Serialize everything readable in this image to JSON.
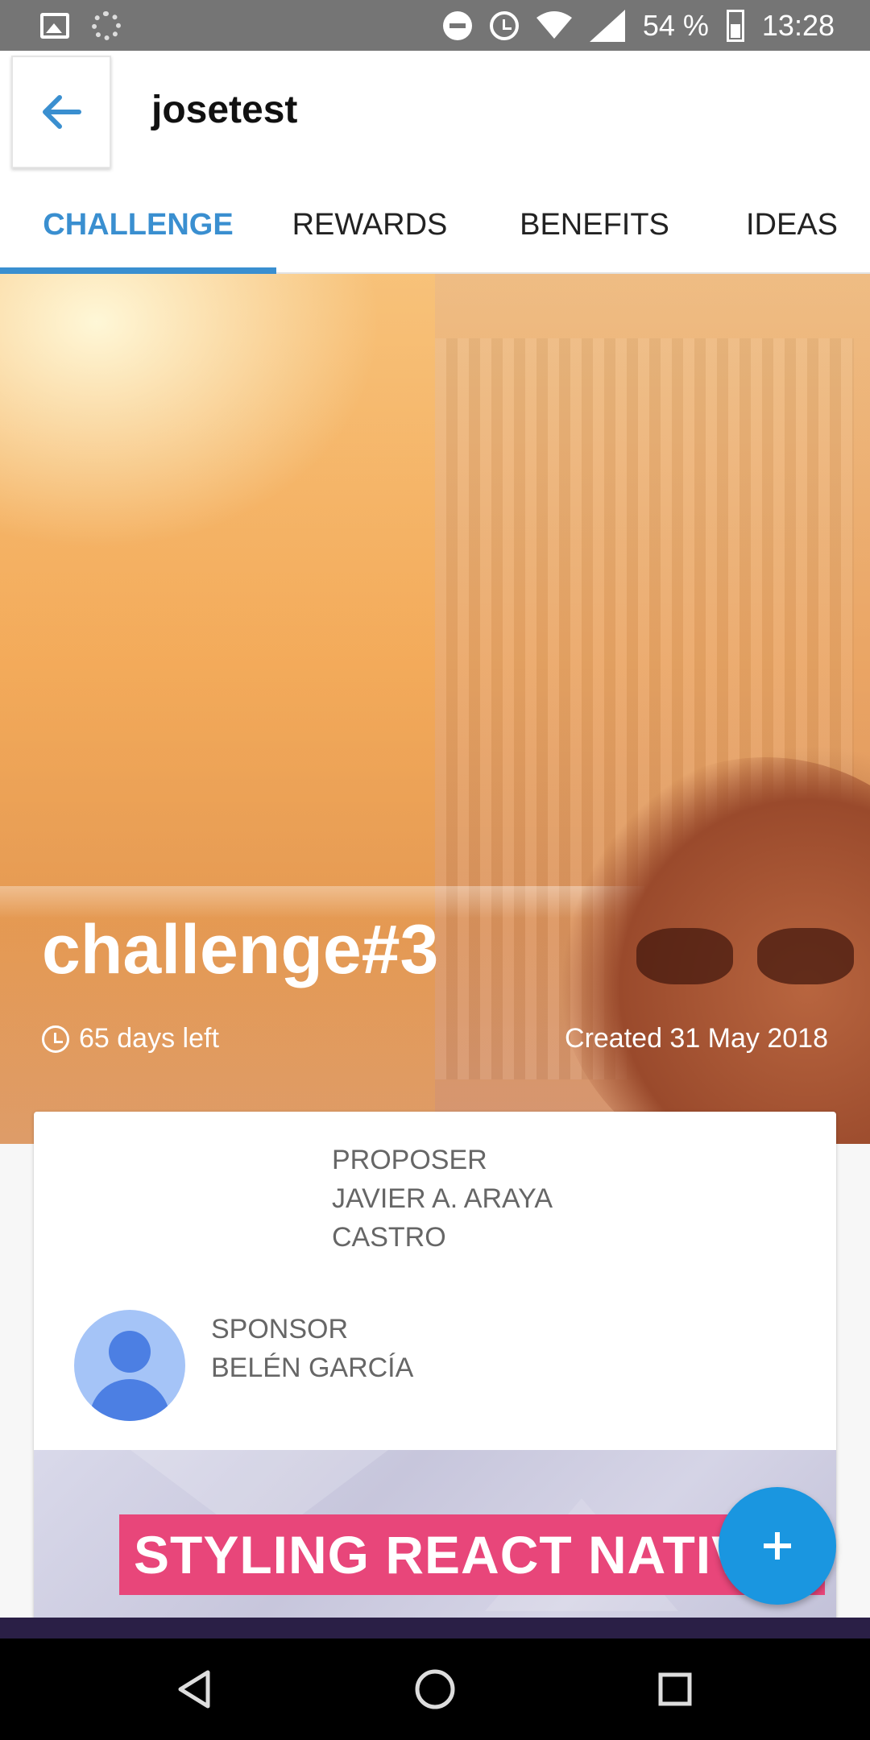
{
  "status_bar": {
    "battery": "54 %",
    "time": "13:28",
    "icons": [
      "image-icon",
      "loading-icon",
      "do-not-disturb-icon",
      "alarm-icon",
      "wifi-icon",
      "cell-signal-icon",
      "battery-icon"
    ]
  },
  "app_bar": {
    "title": "josetest",
    "back_icon": "arrow-left-icon"
  },
  "tabs": [
    {
      "label": "CHALLENGE",
      "active": true
    },
    {
      "label": "REWARDS",
      "active": false
    },
    {
      "label": "BENEFITS",
      "active": false
    },
    {
      "label": "IDEAS",
      "active": false
    }
  ],
  "hero": {
    "title": "challenge#3",
    "time_left": "65 days left",
    "created": "Created 31 May 2018"
  },
  "card": {
    "proposer_label": "PROPOSER",
    "proposer_name_line1": "JAVIER A. ARAYA",
    "proposer_name_line2": "CASTRO",
    "sponsor_label": "SPONSOR",
    "sponsor_name": "BELÉN GARCÍA",
    "banner_text": "STYLING REACT NATIVE"
  },
  "fab": {
    "icon": "plus-icon"
  },
  "colors": {
    "accent": "#3a8fd0",
    "fab": "#1a96e0",
    "banner": "#e8467a",
    "status_bar": "#757575"
  }
}
